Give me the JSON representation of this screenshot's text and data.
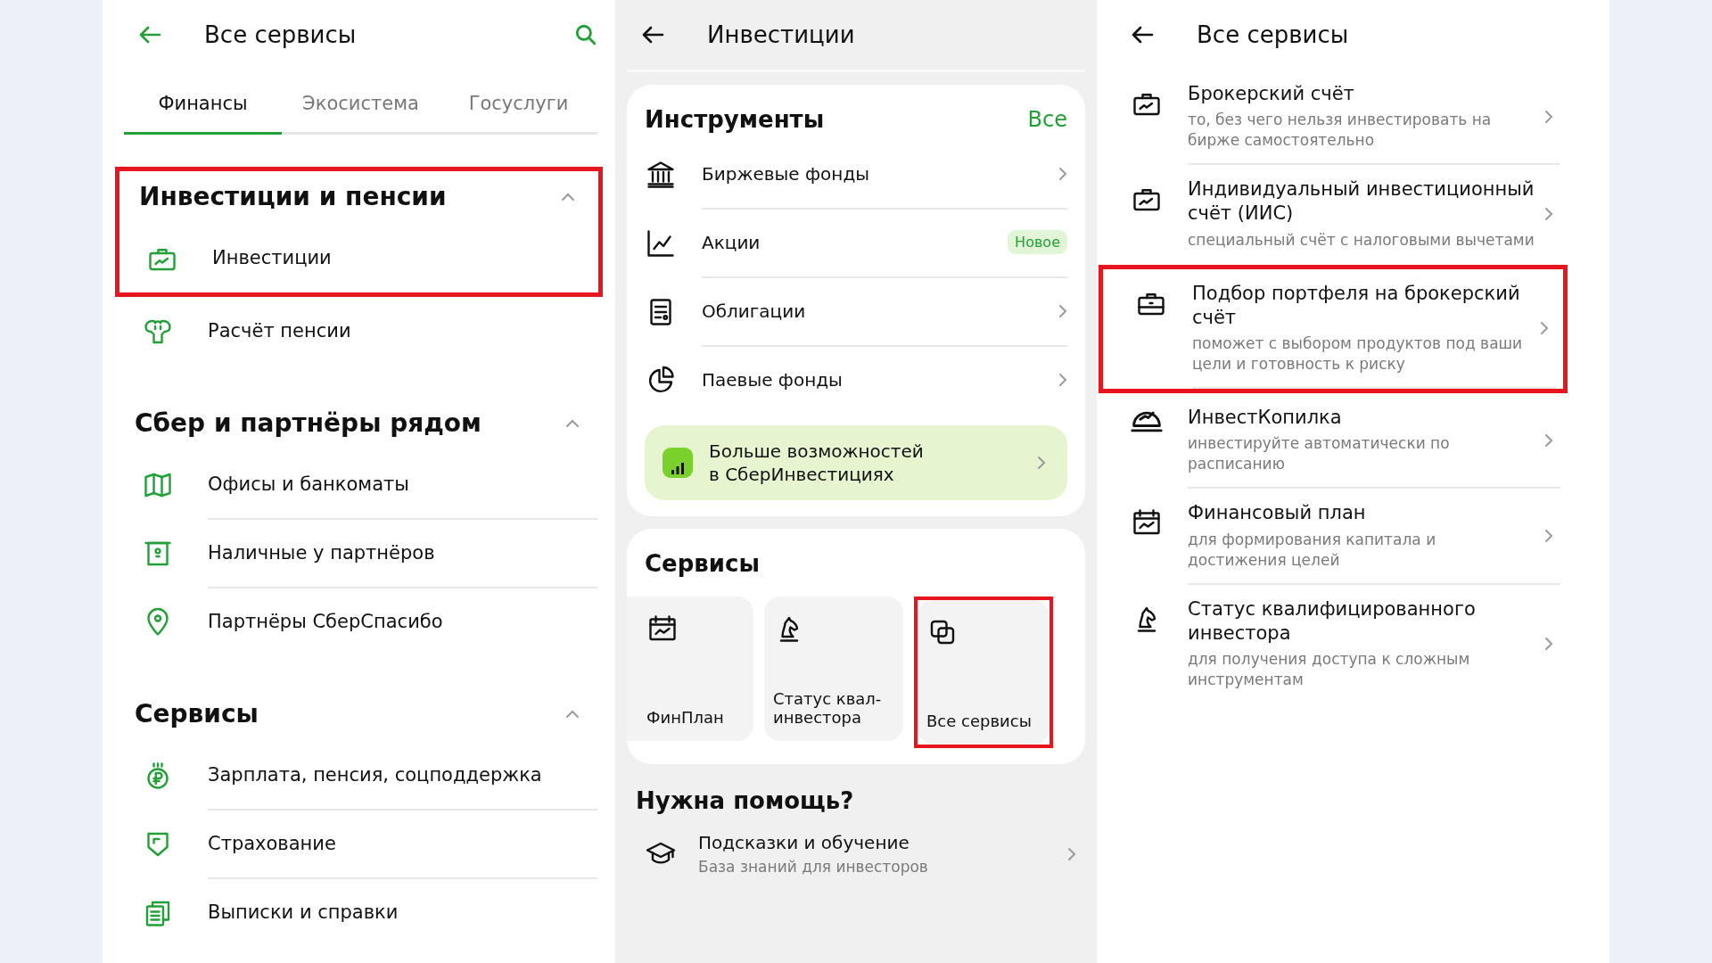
{
  "finance_screen": {
    "header": {
      "title": "Все сервисы"
    },
    "tabs": [
      {
        "label": "Финансы",
        "selected": true
      },
      {
        "label": "Экосистема",
        "selected": false
      },
      {
        "label": "Госуслуги",
        "selected": false
      }
    ],
    "sections": [
      {
        "title": "Инвестиции и пенсии",
        "expanded": true,
        "highlighted": true,
        "items": [
          {
            "label": "Инвестиции",
            "highlighted": true
          },
          {
            "label": "Расчёт пенсии",
            "highlighted": false
          }
        ]
      },
      {
        "title": "Сбер и партнёры рядом",
        "expanded": true,
        "highlighted": false,
        "items": [
          {
            "label": "Офисы и банкоматы",
            "highlighted": false
          },
          {
            "label": "Наличные у партнёров",
            "highlighted": false
          },
          {
            "label": "Партнёры СберСпасибо",
            "highlighted": false
          }
        ]
      },
      {
        "title": "Сервисы",
        "expanded": true,
        "highlighted": false,
        "items": [
          {
            "label": "Зарплата, пенсия, соцподдержка",
            "highlighted": false
          },
          {
            "label": "Страхование",
            "highlighted": false
          },
          {
            "label": "Выписки и справки",
            "highlighted": false
          }
        ]
      }
    ]
  },
  "investments_screen": {
    "header": {
      "title": "Инвестиции"
    },
    "instruments": {
      "title": "Инструменты",
      "link": "Все",
      "items": [
        {
          "label": "Биржевые фонды"
        },
        {
          "label": "Акции",
          "badge": "Новое"
        },
        {
          "label": "Облигации"
        },
        {
          "label": "Паевые фонды"
        }
      ]
    },
    "promo": {
      "text": "Больше возможностей\nв СберИнвестициях"
    },
    "services": {
      "title": "Сервисы",
      "tiles": [
        {
          "label": "ФинПлан",
          "highlighted": false
        },
        {
          "label": "Статус квал-инвестора",
          "highlighted": false
        },
        {
          "label": "Все сервисы",
          "highlighted": true
        }
      ]
    },
    "help": {
      "title": "Нужна помощь?",
      "items": [
        {
          "title": "Подсказки и обучение",
          "subtitle": "База знаний для инвесторов"
        }
      ]
    }
  },
  "all_services_screen": {
    "header": {
      "title": "Все сервисы"
    },
    "items": [
      {
        "title": "Брокерский счёт",
        "subtitle": "то, без чего нельзя инвестировать на бирже самостоятельно",
        "highlighted": false
      },
      {
        "title": "Индивидуальный инвестиционный счёт (ИИС)",
        "subtitle": "специальный счёт с налоговыми вычетами",
        "highlighted": false
      },
      {
        "title": "Подбор портфеля на брокерский счёт",
        "subtitle": "поможет с выбором продуктов под ваши цели и готовность к риску",
        "highlighted": true
      },
      {
        "title": "ИнвестКопилка",
        "subtitle": "инвестируйте автоматически по расписанию",
        "highlighted": false
      },
      {
        "title": "Финансовый план",
        "subtitle": "для формирования капитала и достижения целей",
        "highlighted": false
      },
      {
        "title": "Статус квалифицированного инвестора",
        "subtitle": "для получения доступа к сложным инструментам",
        "highlighted": false
      }
    ]
  }
}
